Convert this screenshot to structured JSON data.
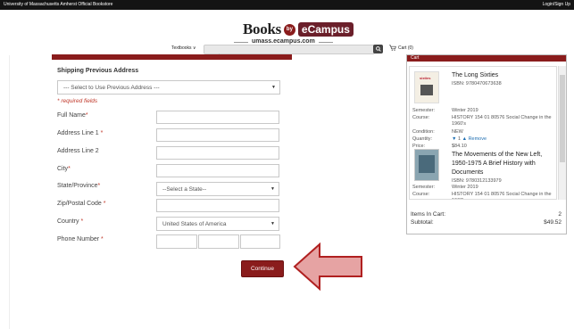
{
  "topbar": {
    "left_text": "University of Massachusetts Amherst Official Bookstore",
    "right_text": "Login/Sign Up"
  },
  "brand": {
    "books": "Books",
    "by": "by",
    "ecampus": "eCampus",
    "url": "umass.ecampus.com"
  },
  "nav": {
    "textbooks_label": "Textbooks",
    "search_placeholder": "Search",
    "cart_label": "Cart (0)"
  },
  "form": {
    "section_title": "Shipping Previous Address",
    "previous_address_select": "--- Select to Use Previous Address ---",
    "required_note": "* required fields",
    "fields": [
      {
        "label": "Full Name",
        "required": "*"
      },
      {
        "label": "Address Line 1",
        "required": "*"
      },
      {
        "label": "Address Line 2",
        "required": ""
      },
      {
        "label": "City",
        "required": "*"
      },
      {
        "label": "State/Province",
        "required": "*"
      },
      {
        "label": "Zip/Postal Code",
        "required": "*"
      },
      {
        "label": "Country",
        "required": "*"
      },
      {
        "label": "Phone Number",
        "required": "*"
      }
    ],
    "state_select": "--Select a State--",
    "country_select": "United States of America",
    "continue_label": "Continue"
  },
  "cart": {
    "header_label": "Cart",
    "items": [
      {
        "title": "The Long Sixties",
        "isbn": "ISBN: 9780470673638",
        "cover_text": "sixties",
        "semester_label": "Semester:",
        "semester": "Winter 2019",
        "course_label": "Course:",
        "course": "HISTORY 154 01 80576 Social Change in the 1960's",
        "condition_label": "Condition:",
        "condition": "NEW",
        "quantity_label": "Quantity:",
        "quantity": "1",
        "remove_label": "Remove",
        "price_label": "Price:",
        "price": "$84.10"
      },
      {
        "title": "The Movements of the New Left, 1950-1975 A Brief History with Documents",
        "isbn": "ISBN: 9780312133979",
        "semester_label": "Semester:",
        "semester": "Winter 2019",
        "course_label": "Course:",
        "course": "HISTORY 154 01 80576 Social Change in the 1960's"
      }
    ],
    "items_in_cart_label": "Items In Cart:",
    "items_in_cart": "2",
    "subtotal_label": "Subtotal:",
    "subtotal": "$49.52"
  },
  "colors": {
    "accent": "#8a1c1c",
    "link": "#1f6fb2",
    "required": "#c0392b"
  }
}
